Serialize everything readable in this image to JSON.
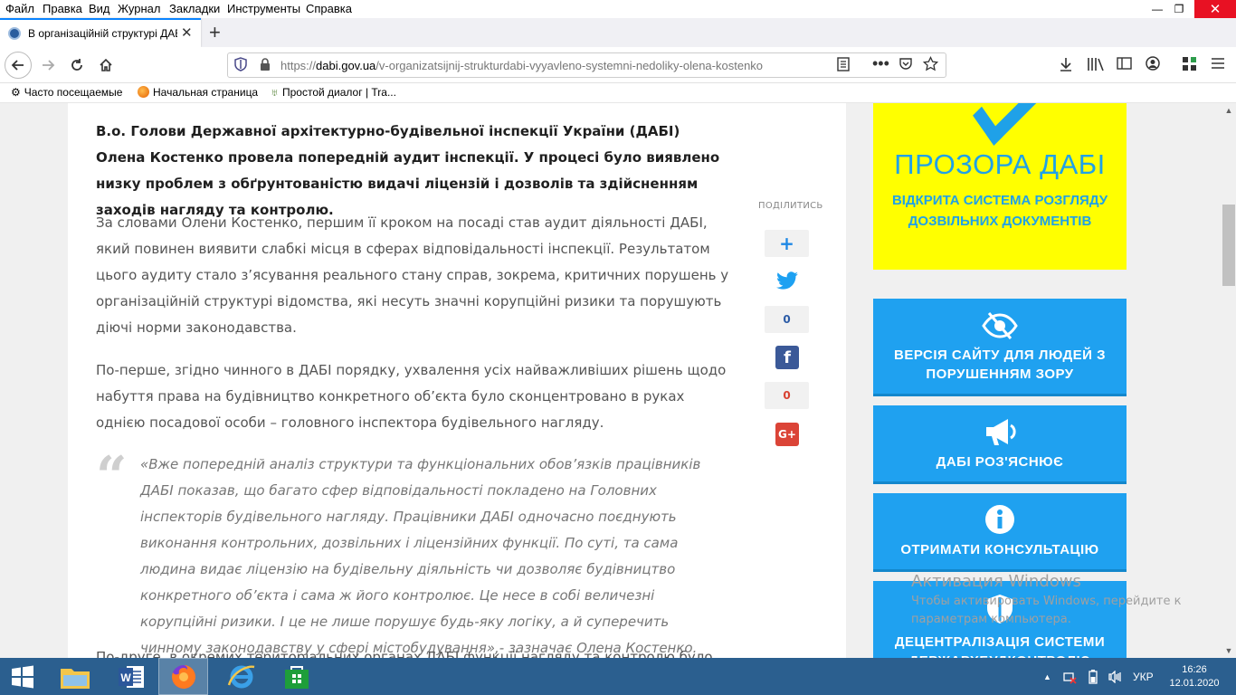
{
  "menubar": {
    "items": [
      "Файл",
      "Правка",
      "Вид",
      "Журнал",
      "Закладки",
      "Инструменты",
      "Справка"
    ]
  },
  "window": {
    "minimize": "—",
    "restore": "❐",
    "close": "✕"
  },
  "tab": {
    "title": "В організаційній структурі ДАБІ",
    "close": "✕",
    "new_tab": "+"
  },
  "nav": {
    "url_host": "https://dabi.gov.ua",
    "url_path": "/v-organizatsijnij-strukturdabi-vyyavleno-systemni-nedoliky-olena-kostenko",
    "url_display_prefix": "https://",
    "url_domain": "dabi.gov.ua",
    "url_rest": "/v-organizatsijnij-strukturdabi-vyyavleno-systemni-nedoliky-olena-kostenko"
  },
  "bookmarks": [
    {
      "label": "Часто посещаемые",
      "icon": "gear-icon"
    },
    {
      "label": "Начальная страница",
      "icon": "firefox-icon"
    },
    {
      "label": "Простой диалог | Tra...",
      "icon": "dialog-icon"
    }
  ],
  "article": {
    "lead": "В.о. Голови Державної архітектурно-будівельної інспекції України (ДАБІ) Олена Костенко провела попередній аудит інспекції. У процесі було виявлено низку проблем з обґрунтованістю видачі ліцензій і дозволів та здійсненням заходів нагляду та контролю.",
    "p1": "За словами Олени Костенко, першим її кроком на посаді став аудит діяльності ДАБІ, який повинен виявити слабкі місця в сферах відповідальності інспекції. Результатом цього аудиту стало з’ясування реального стану справ, зокрема, критичних порушень у організаційній структурі відомства, які несуть значні корупційні ризики та порушують діючі норми законодавства.",
    "p2": "По-перше, згідно чинного в ДАБІ порядку, ухвалення усіх найважливіших рішень щодо набуття права на будівництво конкретного об’єкта було сконцентровано в руках однією посадової особи – головного інспектора будівельного нагляду.",
    "quote": "«Вже попередній аналіз структури та функціональних обов’язків працівників ДАБІ показав, що багато сфер відповідальності покладено на Головних інспекторів будівельного нагляду. Працівники ДАБІ одночасно поєднують виконання контрольних, дозвільних і ліцензійних функції. По суті, та сама людина видає ліцензію на будівельну діяльність чи дозволяє будівництво конкретного об’єкта і сама ж його контролює. Це несе в собі величезні корупційні ризики. І це не лише порушує будь-яку логіку, а й суперечить чинному законодавству у сфері містобудування»,- зазначає Олена Костенко.",
    "p3": "По-друге, в окремих територіальних органах ДАБІ функції нагляду та контролю було"
  },
  "share": {
    "label": "ПОДІЛИТИСЬ",
    "plus": "+",
    "twitter_count": "0",
    "facebook_count": "0",
    "fb_letter": "f",
    "gplus_letter": "G+"
  },
  "sidebar": {
    "yellow": {
      "title": "ПРОЗОРА ДАБІ",
      "subtitle": "ВІДКРИТА СИСТЕМА РОЗГЛЯДУ ДОЗВІЛЬНИХ ДОКУМЕНТІВ"
    },
    "boxes": [
      {
        "label": "ВЕРСІЯ САЙТУ ДЛЯ ЛЮДЕЙ З ПОРУШЕННЯМ ЗОРУ",
        "icon": "eye-slash-icon"
      },
      {
        "label": "ДАБІ РОЗ'ЯСНЮЄ",
        "icon": "megaphone-icon"
      },
      {
        "label": "ОТРИМАТИ КОНСУЛЬТАЦІЮ",
        "icon": "info-icon"
      },
      {
        "label": "ДЕЦЕНТРАЛІЗАЦІЯ СИСТЕМИ ДЕРЖАРХБУДКОНТРОЛЮ",
        "icon": "shield-icon"
      }
    ]
  },
  "activation": {
    "title": "Активация Windows",
    "text": "Чтобы активировать Windows, перейдите к параметрам компьютера."
  },
  "taskbar": {
    "lang": "УКР",
    "time": "16:26",
    "date": "12.01.2020"
  },
  "colors": {
    "accent_blue": "#1fa1f0",
    "yellow": "#ffff00",
    "taskbar": "#2b5f8f",
    "close_red": "#e81123"
  }
}
